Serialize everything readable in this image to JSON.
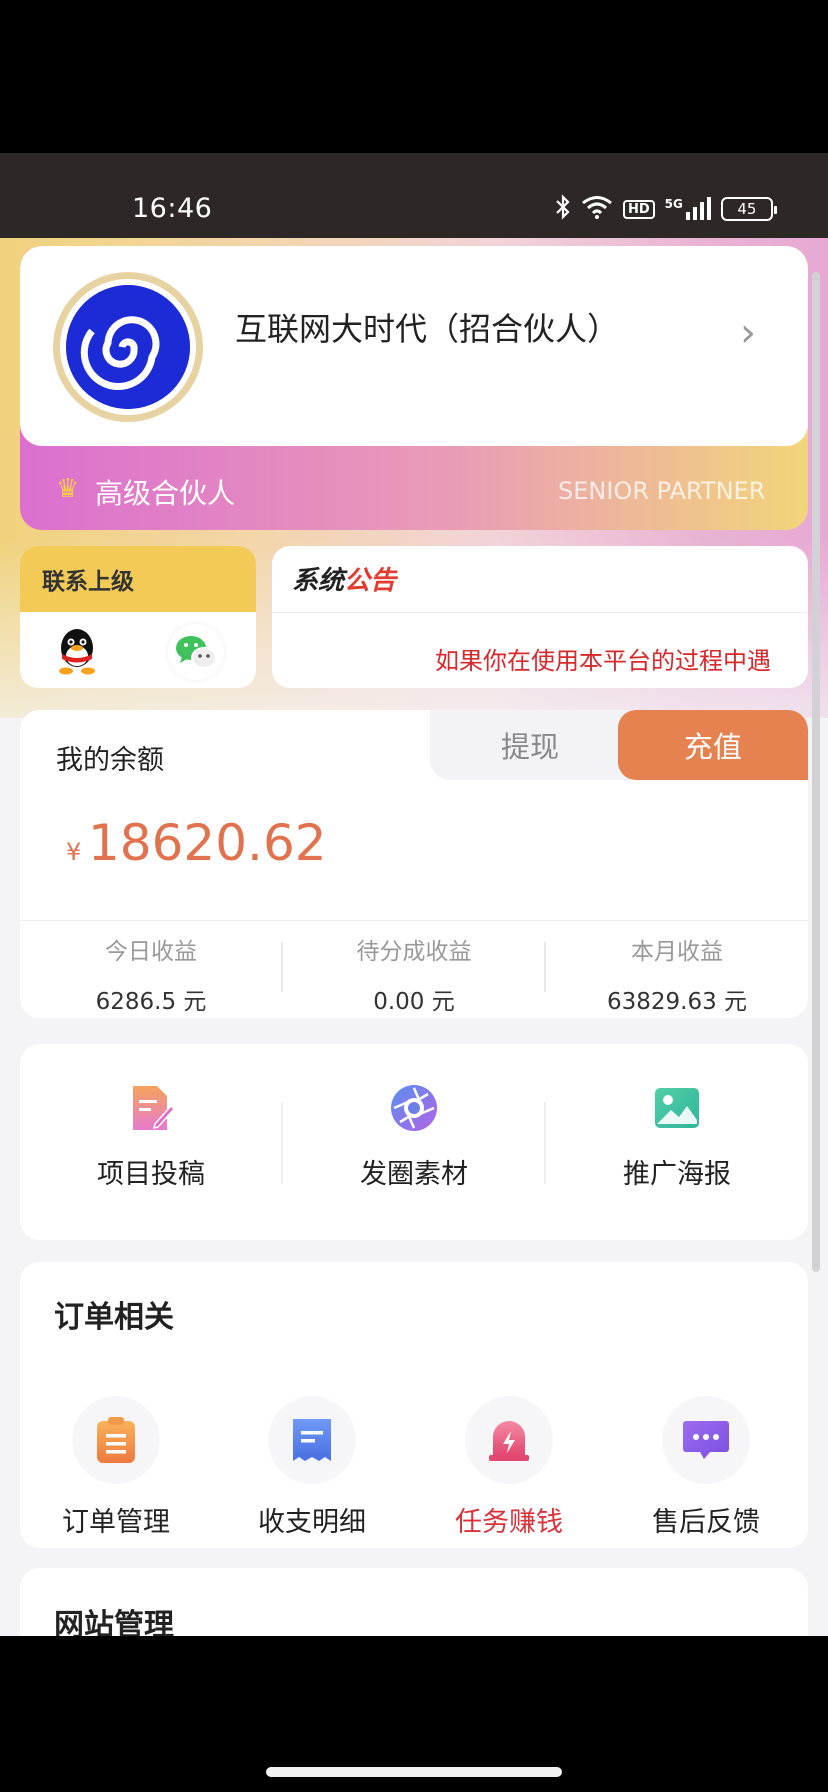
{
  "status_bar": {
    "time": "16:46",
    "icons": [
      "bluetooth-icon",
      "wifi-icon",
      "hd-icon",
      "signal-5g-icon",
      "battery-icon"
    ],
    "hd": "HD",
    "network": "5G",
    "battery": "45"
  },
  "partner": {
    "name": "互联网大时代（招合伙人）",
    "level": "高级合伙人",
    "level_en": "SENIOR PARTNER"
  },
  "contact": {
    "title": "联系上级",
    "icons": [
      "qq-icon",
      "wechat-icon"
    ]
  },
  "notice": {
    "title_black": "系统",
    "title_red": "公告",
    "text": "如果你在使用本平台的过程中遇"
  },
  "balance": {
    "title": "我的余额",
    "withdraw": "提现",
    "recharge": "充值",
    "currency": "¥",
    "amount": "18620.62",
    "stats": [
      {
        "label": "今日收益",
        "value": "6286.5 元"
      },
      {
        "label": "待分成收益",
        "value": "0.00 元"
      },
      {
        "label": "本月收益",
        "value": "63829.63 元"
      }
    ]
  },
  "tools": [
    {
      "label": "项目投稿",
      "icon": "document-edit-icon"
    },
    {
      "label": "发圈素材",
      "icon": "aperture-icon"
    },
    {
      "label": "推广海报",
      "icon": "image-icon"
    }
  ],
  "orders": {
    "title": "订单相关",
    "items": [
      {
        "label": "订单管理",
        "icon": "clipboard-icon"
      },
      {
        "label": "收支明细",
        "icon": "receipt-icon"
      },
      {
        "label": "任务赚钱",
        "icon": "alarm-icon"
      },
      {
        "label": "售后反馈",
        "icon": "chat-bubble-icon"
      }
    ]
  },
  "site": {
    "title": "网站管理"
  },
  "colors": {
    "accent_orange": "#e0734e",
    "recharge_button": "#e5824f",
    "notice_red": "#d8282c",
    "contact_yellow": "#f3ca55"
  }
}
